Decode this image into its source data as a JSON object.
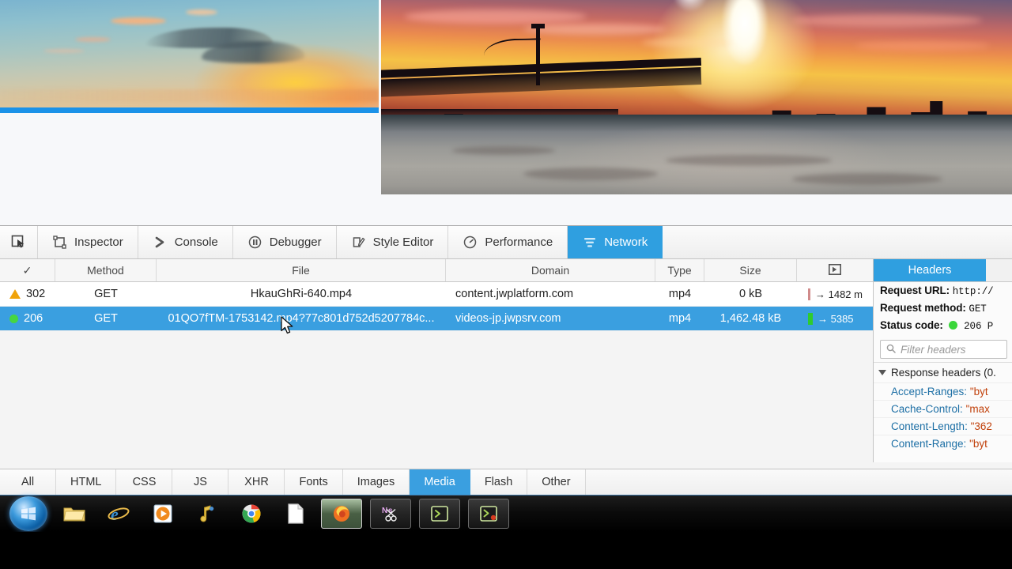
{
  "devtools": {
    "toolbar": {
      "picker_icon": "element-picker-icon",
      "tabs": [
        {
          "label": "Inspector",
          "icon": "inspector-icon",
          "active": false
        },
        {
          "label": "Console",
          "icon": "console-icon",
          "active": false
        },
        {
          "label": "Debugger",
          "icon": "debugger-icon",
          "active": false
        },
        {
          "label": "Style Editor",
          "icon": "style-editor-icon",
          "active": false
        },
        {
          "label": "Performance",
          "icon": "performance-icon",
          "active": false
        },
        {
          "label": "Network",
          "icon": "network-icon",
          "active": true
        }
      ]
    },
    "network_table": {
      "columns": [
        "✓",
        "Method",
        "File",
        "Domain",
        "Type",
        "Size",
        "timeline-icon"
      ],
      "rows": [
        {
          "status_icon": "warning-triangle-icon",
          "status": "302",
          "method": "GET",
          "file": "HkauGhRi-640.mp4",
          "domain": "content.jwplatform.com",
          "type": "mp4",
          "size": "0 kB",
          "timeline": "→ 1482 m",
          "selected": false
        },
        {
          "status_icon": "green-dot-icon",
          "status": "206",
          "method": "GET",
          "file": "01QO7fTM-1753142.mp4?77c801d752d5207784c...",
          "domain": "videos-jp.jwpsrv.com",
          "type": "mp4",
          "size": "1,462.48 kB",
          "timeline": "→ 5385",
          "selected": true
        }
      ]
    },
    "headers_panel": {
      "tab_label": "Headers",
      "request_url_label": "Request URL:",
      "request_url_value": "http://",
      "request_method_label": "Request method:",
      "request_method_value": "GET",
      "status_code_label": "Status code:",
      "status_code_value": "206  P",
      "filter_placeholder": "Filter headers",
      "search_icon": "search-icon",
      "section_label": "Response headers (0.",
      "headers": [
        {
          "name": "Accept-Ranges:",
          "value": "\"byt"
        },
        {
          "name": "Cache-Control:",
          "value": "\"max"
        },
        {
          "name": "Content-Length:",
          "value": "\"362"
        },
        {
          "name": "Content-Range:",
          "value": "\"byt"
        }
      ]
    },
    "filter_bar": {
      "buttons": [
        {
          "label": "All",
          "active": false
        },
        {
          "label": "HTML",
          "active": false
        },
        {
          "label": "CSS",
          "active": false
        },
        {
          "label": "JS",
          "active": false
        },
        {
          "label": "XHR",
          "active": false
        },
        {
          "label": "Fonts",
          "active": false
        },
        {
          "label": "Images",
          "active": false
        },
        {
          "label": "Media",
          "active": true
        },
        {
          "label": "Flash",
          "active": false
        },
        {
          "label": "Other",
          "active": false
        }
      ]
    }
  },
  "page": {
    "video_left": {
      "name": "sunset-sky-video",
      "progress_bar": "video-progress-bar"
    },
    "video_right": {
      "name": "nyc-skyline-sunset-video"
    }
  },
  "taskbar": {
    "start_button": "windows-start-orb",
    "items": [
      {
        "name": "file-explorer-icon",
        "pinned": true,
        "running": false
      },
      {
        "name": "internet-explorer-icon",
        "pinned": true,
        "running": false
      },
      {
        "name": "media-player-icon",
        "pinned": true,
        "running": false
      },
      {
        "name": "itunes-icon",
        "pinned": true,
        "running": false
      },
      {
        "name": "google-chrome-icon",
        "pinned": true,
        "running": false
      },
      {
        "name": "document-icon",
        "pinned": true,
        "running": false
      },
      {
        "name": "firefox-window-button",
        "pinned": false,
        "running": true
      },
      {
        "name": "snipping-tool-button",
        "pinned": false,
        "running": false
      },
      {
        "name": "terminal-window-button",
        "pinned": false,
        "running": false
      },
      {
        "name": "terminal-window-button-2",
        "pinned": false,
        "running": false
      }
    ]
  },
  "colors": {
    "accent_blue": "#2f9fe0",
    "selected_row": "#3a9fe0",
    "progress_bar": "#1b92e8",
    "status_ok": "#46d640",
    "status_warn": "#f0a30a",
    "header_name": "#1d6fa5",
    "header_value": "#c1410b"
  }
}
